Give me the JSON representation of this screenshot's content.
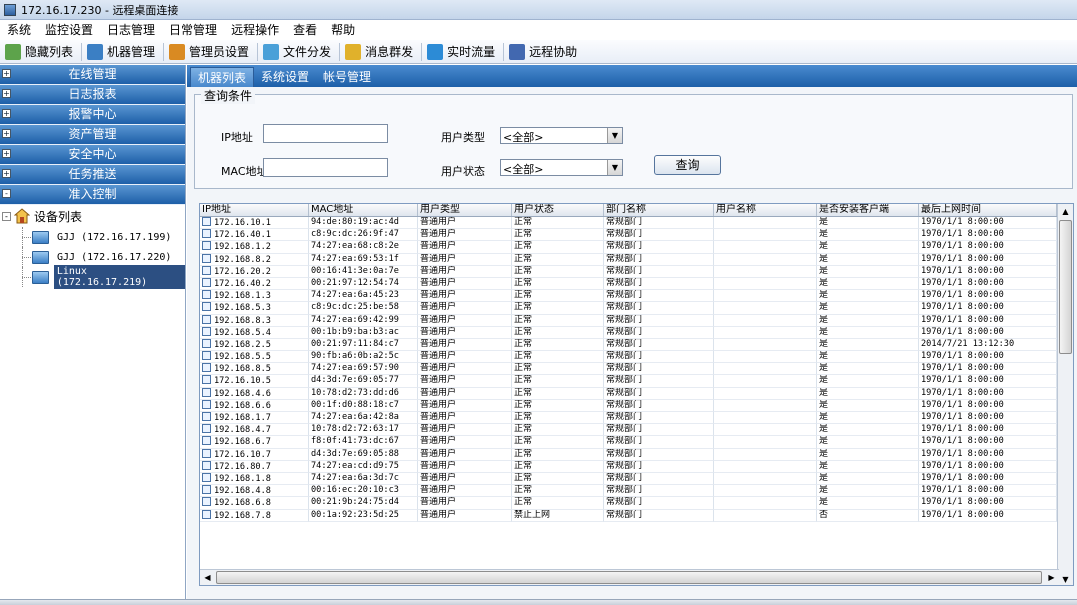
{
  "window": {
    "title": "172.16.17.230 - 远程桌面连接"
  },
  "menu": [
    "系统",
    "监控设置",
    "日志管理",
    "日常管理",
    "远程操作",
    "查看",
    "帮助"
  ],
  "toolbar": [
    {
      "label": "隐藏列表",
      "icon": "hide-list-icon",
      "color": "#5da34b"
    },
    {
      "label": "机器管理",
      "icon": "machine-icon",
      "color": "#3b7fc4"
    },
    {
      "label": "管理员设置",
      "icon": "admin-icon",
      "color": "#d98a22"
    },
    {
      "label": "文件分发",
      "icon": "file-distribute-icon",
      "color": "#4aa0d8"
    },
    {
      "label": "消息群发",
      "icon": "message-icon",
      "color": "#e0b12b"
    },
    {
      "label": "实时流量",
      "icon": "traffic-icon",
      "color": "#2c8bd6"
    },
    {
      "label": "远程协助",
      "icon": "remote-assist-icon",
      "color": "#4268b0"
    }
  ],
  "sidebar": {
    "items": [
      {
        "label": "在线管理",
        "toggle": "+"
      },
      {
        "label": "日志报表",
        "toggle": "+"
      },
      {
        "label": "报警中心",
        "toggle": "+"
      },
      {
        "label": "资产管理",
        "toggle": "+"
      },
      {
        "label": "安全中心",
        "toggle": "+"
      },
      {
        "label": "任务推送",
        "toggle": "+"
      },
      {
        "label": "准入控制",
        "toggle": "-"
      }
    ],
    "tree": {
      "root": "设备列表",
      "root_toggle": "-",
      "nodes": [
        {
          "label": "GJJ (172.16.17.199)"
        },
        {
          "label": "GJJ (172.16.17.220)"
        },
        {
          "label": "Linux (172.16.17.219)"
        }
      ]
    }
  },
  "tabs": [
    "机器列表",
    "系统设置",
    "帐号管理"
  ],
  "query": {
    "legend": "查询条件",
    "ip_label": "IP地址",
    "ip_value": "",
    "mac_label": "MAC地址",
    "mac_value": "",
    "usertype_label": "用户类型",
    "usertype_value": "<全部>",
    "userstatus_label": "用户状态",
    "userstatus_value": "<全部>",
    "search_button": "查询"
  },
  "grid": {
    "columns": [
      "IP地址",
      "MAC地址",
      "用户类型",
      "用户状态",
      "部门名称",
      "用户名称",
      "是否安装客户端",
      "最后上网时间"
    ],
    "rows": [
      [
        "172.16.10.1",
        "94:de:80:19:ac:4d",
        "普通用户",
        "正常",
        "常规部门",
        "",
        "是",
        "1970/1/1 8:00:00"
      ],
      [
        "172.16.40.1",
        "c8:9c:dc:26:9f:47",
        "普通用户",
        "正常",
        "常规部门",
        "",
        "是",
        "1970/1/1 8:00:00"
      ],
      [
        "192.168.1.2",
        "74:27:ea:68:c8:2e",
        "普通用户",
        "正常",
        "常规部门",
        "",
        "是",
        "1970/1/1 8:00:00"
      ],
      [
        "192.168.8.2",
        "74:27:ea:69:53:1f",
        "普通用户",
        "正常",
        "常规部门",
        "",
        "是",
        "1970/1/1 8:00:00"
      ],
      [
        "172.16.20.2",
        "00:16:41:3e:0a:7e",
        "普通用户",
        "正常",
        "常规部门",
        "",
        "是",
        "1970/1/1 8:00:00"
      ],
      [
        "172.16.40.2",
        "00:21:97:12:54:74",
        "普通用户",
        "正常",
        "常规部门",
        "",
        "是",
        "1970/1/1 8:00:00"
      ],
      [
        "192.168.1.3",
        "74:27:ea:6a:45:23",
        "普通用户",
        "正常",
        "常规部门",
        "",
        "是",
        "1970/1/1 8:00:00"
      ],
      [
        "192.168.5.3",
        "c8:9c:dc:25:be:58",
        "普通用户",
        "正常",
        "常规部门",
        "",
        "是",
        "1970/1/1 8:00:00"
      ],
      [
        "192.168.8.3",
        "74:27:ea:69:42:99",
        "普通用户",
        "正常",
        "常规部门",
        "",
        "是",
        "1970/1/1 8:00:00"
      ],
      [
        "192.168.5.4",
        "00:1b:b9:ba:b3:ac",
        "普通用户",
        "正常",
        "常规部门",
        "",
        "是",
        "1970/1/1 8:00:00"
      ],
      [
        "192.168.2.5",
        "00:21:97:11:84:c7",
        "普通用户",
        "正常",
        "常规部门",
        "",
        "是",
        "2014/7/21 13:12:30"
      ],
      [
        "192.168.5.5",
        "90:fb:a6:0b:a2:5c",
        "普通用户",
        "正常",
        "常规部门",
        "",
        "是",
        "1970/1/1 8:00:00"
      ],
      [
        "192.168.8.5",
        "74:27:ea:69:57:90",
        "普通用户",
        "正常",
        "常规部门",
        "",
        "是",
        "1970/1/1 8:00:00"
      ],
      [
        "172.16.10.5",
        "d4:3d:7e:69:05:77",
        "普通用户",
        "正常",
        "常规部门",
        "",
        "是",
        "1970/1/1 8:00:00"
      ],
      [
        "192.168.4.6",
        "10:78:d2:73:dd:d6",
        "普通用户",
        "正常",
        "常规部门",
        "",
        "是",
        "1970/1/1 8:00:00"
      ],
      [
        "192.168.6.6",
        "00:1f:d0:88:18:c7",
        "普通用户",
        "正常",
        "常规部门",
        "",
        "是",
        "1970/1/1 8:00:00"
      ],
      [
        "192.168.1.7",
        "74:27:ea:6a:42:8a",
        "普通用户",
        "正常",
        "常规部门",
        "",
        "是",
        "1970/1/1 8:00:00"
      ],
      [
        "192.168.4.7",
        "10:78:d2:72:63:17",
        "普通用户",
        "正常",
        "常规部门",
        "",
        "是",
        "1970/1/1 8:00:00"
      ],
      [
        "192.168.6.7",
        "f8:0f:41:73:dc:67",
        "普通用户",
        "正常",
        "常规部门",
        "",
        "是",
        "1970/1/1 8:00:00"
      ],
      [
        "172.16.10.7",
        "d4:3d:7e:69:05:88",
        "普通用户",
        "正常",
        "常规部门",
        "",
        "是",
        "1970/1/1 8:00:00"
      ],
      [
        "172.16.80.7",
        "74:27:ea:cd:d9:75",
        "普通用户",
        "正常",
        "常规部门",
        "",
        "是",
        "1970/1/1 8:00:00"
      ],
      [
        "192.168.1.8",
        "74:27:ea:6a:3d:7c",
        "普通用户",
        "正常",
        "常规部门",
        "",
        "是",
        "1970/1/1 8:00:00"
      ],
      [
        "192.168.4.8",
        "00:16:ec:20:10:c3",
        "普通用户",
        "正常",
        "常规部门",
        "",
        "是",
        "1970/1/1 8:00:00"
      ],
      [
        "192.168.6.8",
        "00:21:9b:24:75:d4",
        "普通用户",
        "正常",
        "常规部门",
        "",
        "是",
        "1970/1/1 8:00:00"
      ],
      [
        "192.168.7.8",
        "00:1a:92:23:5d:25",
        "普通用户",
        "禁止上网",
        "常规部门",
        "",
        "否",
        "1970/1/1 8:00:00"
      ]
    ]
  }
}
